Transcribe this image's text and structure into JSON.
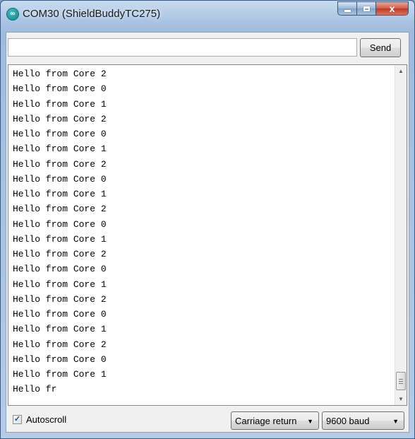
{
  "window": {
    "title": "COM30 (ShieldBuddyTC275)",
    "icon": "arduino-icon",
    "icon_glyph": "∞",
    "controls": {
      "close_glyph": "x"
    }
  },
  "input": {
    "value": "",
    "placeholder": ""
  },
  "send_button": {
    "label": "Send"
  },
  "output": {
    "lines": [
      "Hello from Core 2",
      "Hello from Core 0",
      "Hello from Core 1",
      "Hello from Core 2",
      "Hello from Core 0",
      "Hello from Core 1",
      "Hello from Core 2",
      "Hello from Core 0",
      "Hello from Core 1",
      "Hello from Core 2",
      "Hello from Core 0",
      "Hello from Core 1",
      "Hello from Core 2",
      "Hello from Core 0",
      "Hello from Core 1",
      "Hello from Core 2",
      "Hello from Core 0",
      "Hello from Core 1",
      "Hello from Core 2",
      "Hello from Core 0",
      "Hello from Core 1",
      "Hello fr"
    ]
  },
  "footer": {
    "autoscroll": {
      "label": "Autoscroll",
      "checked": true,
      "check_glyph": "✓"
    },
    "line_ending": {
      "selected": "Carriage return"
    },
    "baud": {
      "selected": "9600 baud"
    }
  }
}
